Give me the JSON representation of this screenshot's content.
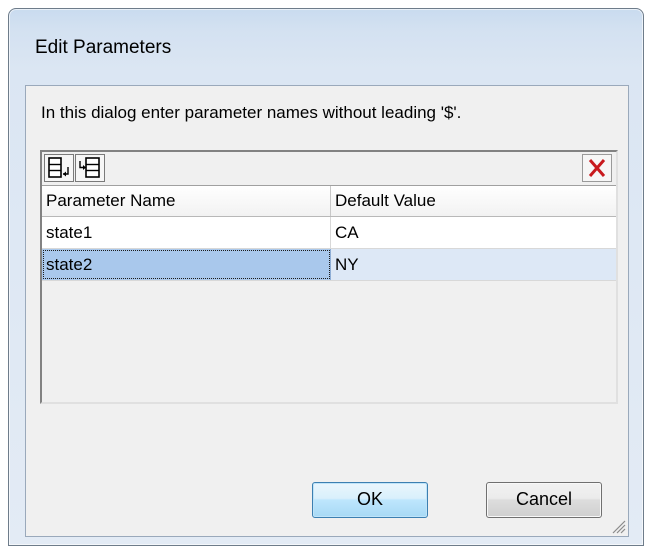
{
  "dialog": {
    "title": "Edit Parameters",
    "instruction": "In this dialog enter parameter names without leading '$'."
  },
  "toolbar": {
    "add_icon": "append-row-icon",
    "insert_icon": "insert-row-icon",
    "delete_icon": "delete-x-icon"
  },
  "grid": {
    "columns": [
      "Parameter Name",
      "Default Value"
    ],
    "rows": [
      {
        "name": "state1",
        "value": "CA"
      },
      {
        "name": "state2",
        "value": "NY"
      }
    ]
  },
  "buttons": {
    "ok": "OK",
    "cancel": "Cancel"
  },
  "colors": {
    "selection": "#a9c8ec",
    "row_highlight": "#dde8f6",
    "delete_red": "#c8191e"
  }
}
